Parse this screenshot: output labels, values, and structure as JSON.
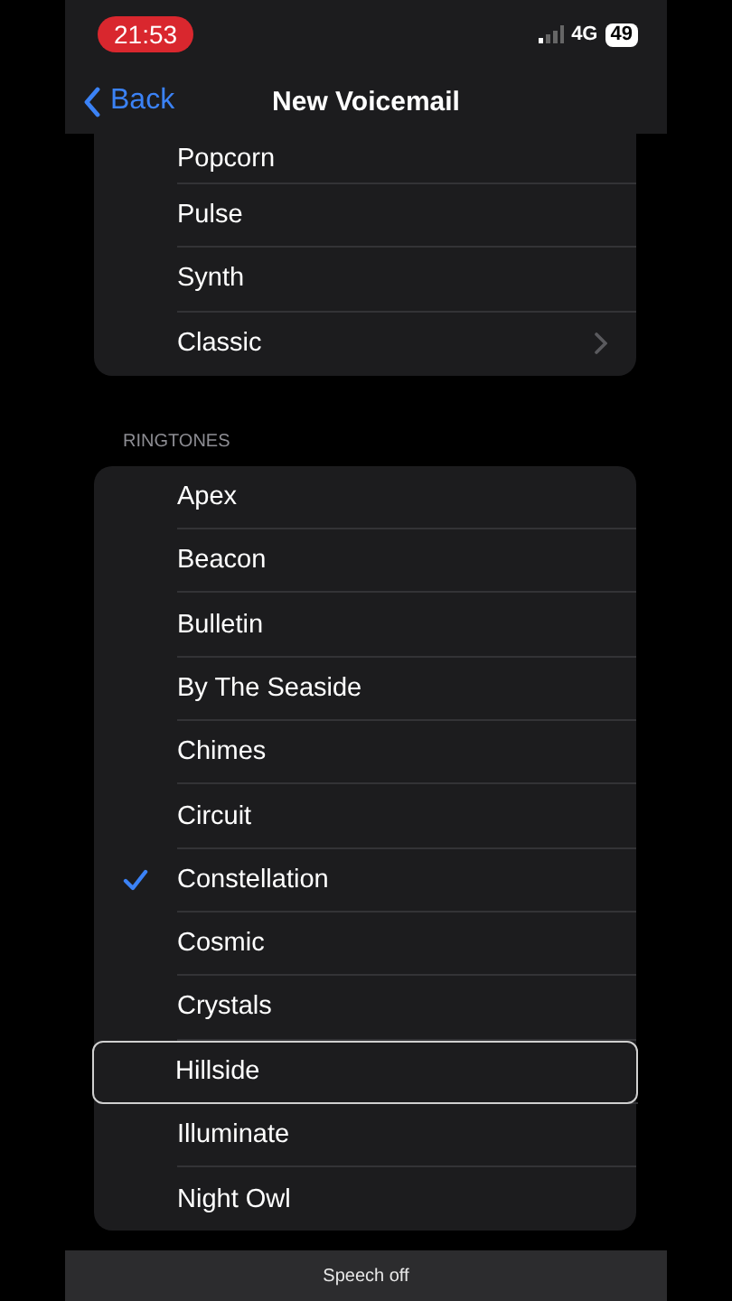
{
  "status_bar": {
    "time": "21:53",
    "network": "4G",
    "battery": "49"
  },
  "nav": {
    "back": "Back",
    "title": "New Voicemail"
  },
  "alert_tones": [
    {
      "label": "Popcorn",
      "chevron": false
    },
    {
      "label": "Pulse",
      "chevron": false
    },
    {
      "label": "Synth",
      "chevron": false
    },
    {
      "label": "Classic",
      "chevron": true
    }
  ],
  "ringtones_header": "RINGTONES",
  "ringtones": [
    {
      "label": "Apex",
      "selected": false,
      "focused": false
    },
    {
      "label": "Beacon",
      "selected": false,
      "focused": false
    },
    {
      "label": "Bulletin",
      "selected": false,
      "focused": false
    },
    {
      "label": "By The Seaside",
      "selected": false,
      "focused": false
    },
    {
      "label": "Chimes",
      "selected": false,
      "focused": false
    },
    {
      "label": "Circuit",
      "selected": false,
      "focused": false
    },
    {
      "label": "Constellation",
      "selected": true,
      "focused": false
    },
    {
      "label": "Cosmic",
      "selected": false,
      "focused": false
    },
    {
      "label": "Crystals",
      "selected": false,
      "focused": false
    },
    {
      "label": "Hillside",
      "selected": false,
      "focused": true
    },
    {
      "label": "Illuminate",
      "selected": false,
      "focused": false
    },
    {
      "label": "Night Owl",
      "selected": false,
      "focused": false
    }
  ],
  "toast": "Speech off"
}
